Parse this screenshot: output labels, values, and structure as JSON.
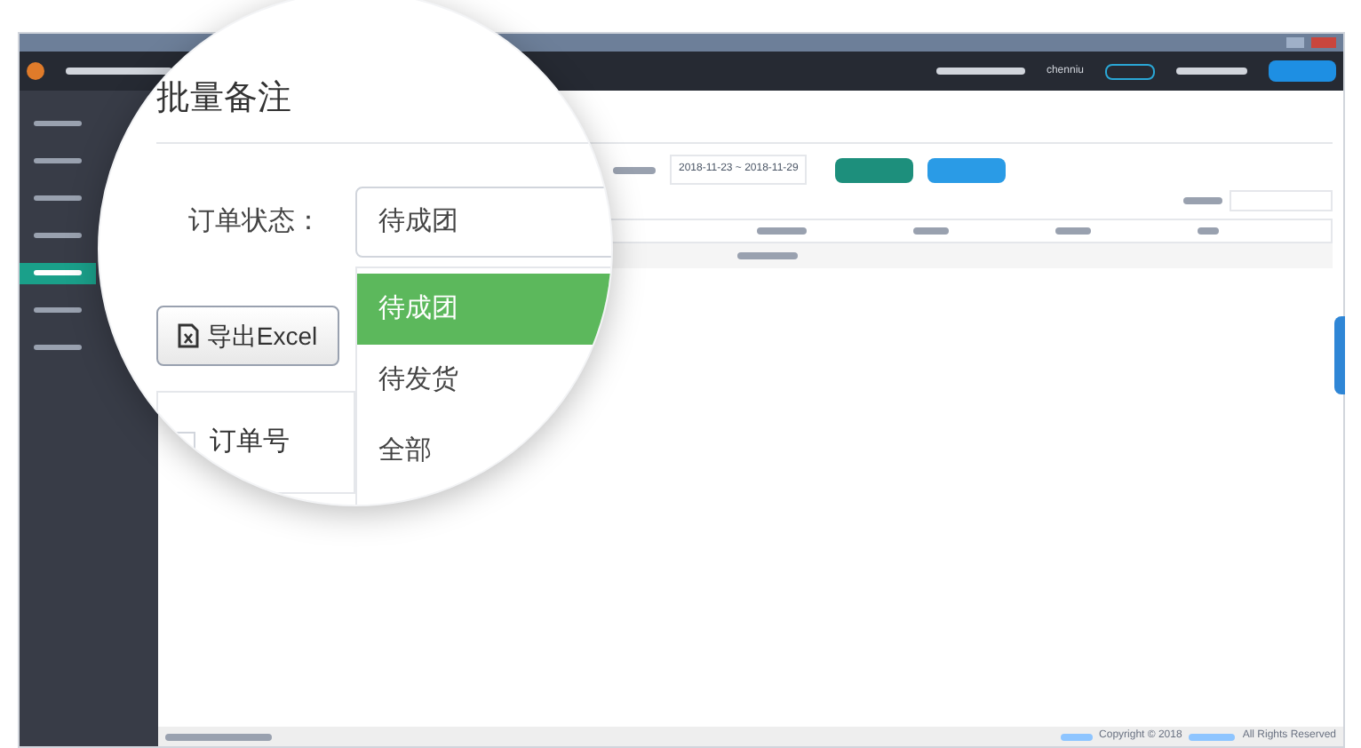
{
  "header": {
    "username": "chenniu"
  },
  "sidebar": [
    {
      "selected": false
    },
    {
      "selected": false
    },
    {
      "selected": false
    },
    {
      "selected": false
    },
    {
      "selected": true
    },
    {
      "selected": false
    },
    {
      "selected": false
    }
  ],
  "filter": {
    "date_range": "2018-11-23 ~ 2018-11-29"
  },
  "footer": {
    "copyright": "Copyright © 2018",
    "rights": "All Rights Reserved"
  },
  "magnifier": {
    "title": "批量备注",
    "status_label": "订单状态：",
    "select_value": "待成团",
    "options": [
      {
        "label": "待成团",
        "selected": true
      },
      {
        "label": "待发货",
        "selected": false
      },
      {
        "label": "全部",
        "selected": false
      }
    ],
    "export_button": "导出Excel",
    "table_header": "订单号",
    "header_checked": false
  }
}
